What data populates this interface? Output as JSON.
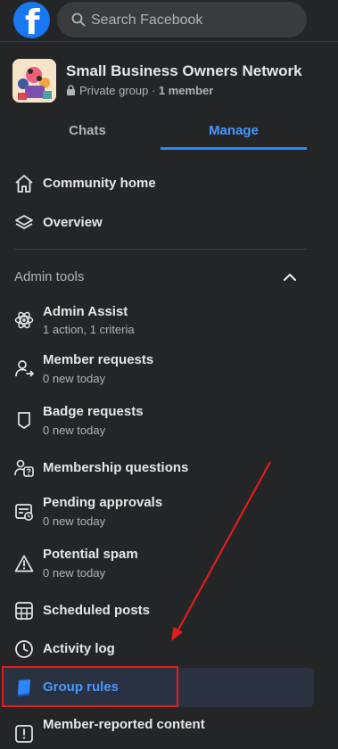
{
  "search": {
    "placeholder": "Search Facebook"
  },
  "group": {
    "name": "Small Business Owners Network",
    "privacy": "Private group",
    "separator": " · ",
    "members": "1 member"
  },
  "tabs": [
    {
      "label": "Chats",
      "active": false
    },
    {
      "label": "Manage",
      "active": true
    }
  ],
  "nav": {
    "community_home": "Community home",
    "overview": "Overview"
  },
  "admin_tools": {
    "title": "Admin tools",
    "items": [
      {
        "label": "Admin Assist",
        "sub": "1 action, 1 criteria",
        "icon": "admin-assist-icon"
      },
      {
        "label": "Member requests",
        "sub": "0 new today",
        "icon": "member-requests-icon"
      },
      {
        "label": "Badge requests",
        "sub": "0 new today",
        "icon": "badge-icon"
      },
      {
        "label": "Membership questions",
        "sub": "",
        "icon": "membership-questions-icon"
      },
      {
        "label": "Pending approvals",
        "sub": "0 new today",
        "icon": "pending-approvals-icon"
      },
      {
        "label": "Potential spam",
        "sub": "0 new today",
        "icon": "warning-icon"
      },
      {
        "label": "Scheduled posts",
        "sub": "",
        "icon": "calendar-icon"
      },
      {
        "label": "Activity log",
        "sub": "",
        "icon": "clock-icon"
      },
      {
        "label": "Group rules",
        "sub": "",
        "icon": "book-icon",
        "selected": true
      },
      {
        "label": "Member-reported content",
        "sub": "",
        "icon": "report-icon"
      }
    ]
  },
  "colors": {
    "background": "#242526",
    "accent": "#2d88ff",
    "annotation": "#e51c1c"
  }
}
